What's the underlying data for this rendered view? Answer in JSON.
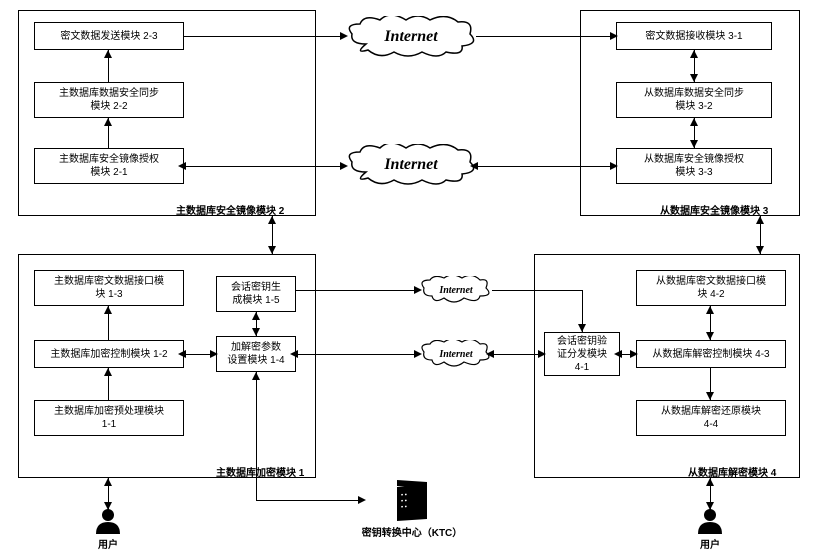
{
  "clouds": {
    "top": "Internet",
    "mid": "Internet",
    "small1": "Internet",
    "small2": "Internet"
  },
  "quadrants": {
    "tl_label": "主数据库安全镜像模块 2",
    "tr_label": "从数据库安全镜像模块 3",
    "bl_label": "主数据库加密模块 1",
    "br_label": "从数据库解密模块 4"
  },
  "modules": {
    "m23": "密文数据发送模块 2-3",
    "m22": "主数据库数据安全同步\n模块 2-2",
    "m21": "主数据库安全镜像授权\n模块 2-1",
    "m31": "密文数据接收模块 3-1",
    "m32": "从数据库数据安全同步\n模块 3-2",
    "m33": "从数据库安全镜像授权\n模块 3-3",
    "m13": "主数据库密文数据接口模\n块 1-3",
    "m12": "主数据库加密控制模块 1-2",
    "m11": "主数据库加密预处理模块\n1-1",
    "m15": "会话密钥生\n成模块 1-5",
    "m14": "加解密参数\n设置模块 1-4",
    "m41": "会话密钥验\n证分发模块\n4-1",
    "m42": "从数据库密文数据接口模\n块 4-2",
    "m43": "从数据库解密控制模块 4-3",
    "m44": "从数据库解密还原模块\n4-4"
  },
  "actors": {
    "user": "用户",
    "ktc": "密钥转换中心（KTC）"
  }
}
